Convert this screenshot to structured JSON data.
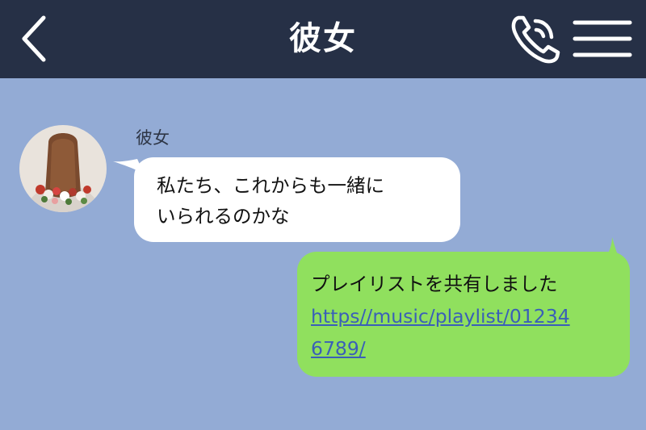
{
  "header": {
    "title": "彼女",
    "back_icon": "chevron-left-icon",
    "call_icon": "phone-icon",
    "menu_icon": "menu-icon",
    "background": "#263046"
  },
  "chat": {
    "background": "#93ABD5",
    "messages": [
      {
        "direction": "incoming",
        "sender": "彼女",
        "avatar": "avatar-photo",
        "text": "私たち、これからも一緒に\nいられるのかな"
      },
      {
        "direction": "outgoing",
        "text": "プレイリストを共有しました",
        "link": "https//music/playlist/01234\n6789/"
      }
    ]
  },
  "colors": {
    "incoming_bubble": "#FFFFFF",
    "outgoing_bubble": "#90E05E",
    "link": "#3A5FB8"
  }
}
